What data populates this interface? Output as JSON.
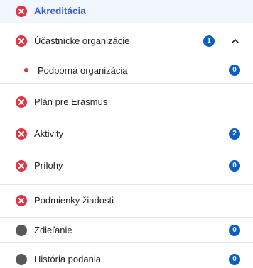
{
  "colors": {
    "error_red": "#e03546",
    "neutral_grey": "#595959",
    "badge_blue": "#0d5ebd",
    "active_text": "#3b5bdb",
    "active_bg": "#f2f7fd"
  },
  "items": [
    {
      "label": "Akreditácia",
      "status": "error",
      "active": true,
      "badge": null
    },
    {
      "label": "Účastnícke organizácie",
      "status": "error",
      "active": false,
      "badge": "1",
      "expanded": true
    },
    {
      "label": "Podporná organizácia",
      "status": "error-dot",
      "active": false,
      "badge": "0",
      "sub": true
    },
    {
      "label": "Plán pre Erasmus",
      "status": "error",
      "active": false,
      "badge": null
    },
    {
      "label": "Aktivity",
      "status": "error",
      "active": false,
      "badge": "2"
    },
    {
      "label": "Prílohy",
      "status": "error",
      "active": false,
      "badge": "0"
    },
    {
      "label": "Podmienky žiadosti",
      "status": "error",
      "active": false,
      "badge": null
    },
    {
      "label": "Zdieľanie",
      "status": "neutral",
      "active": false,
      "badge": "0"
    },
    {
      "label": "História podania",
      "status": "neutral",
      "active": false,
      "badge": "0"
    }
  ]
}
